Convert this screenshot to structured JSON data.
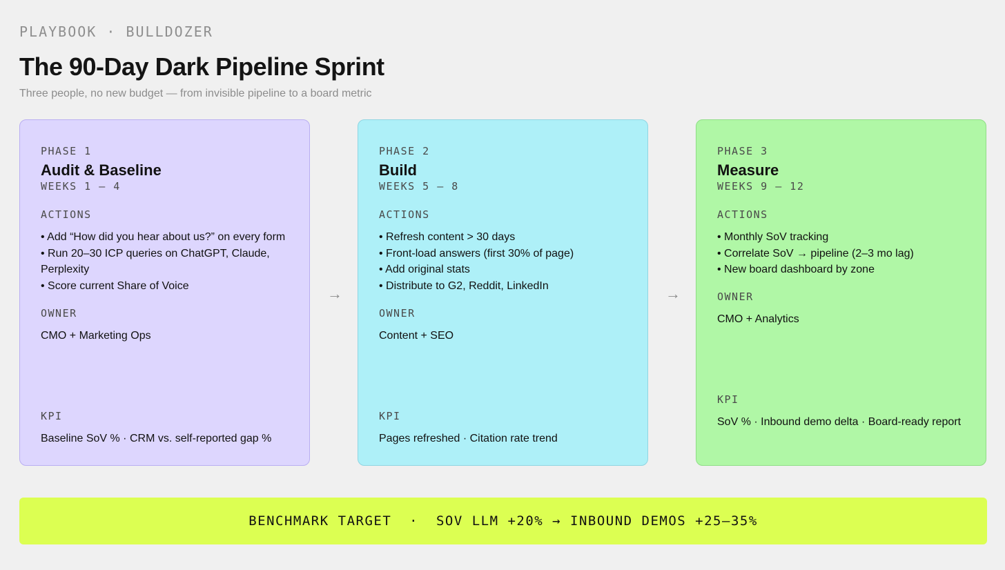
{
  "header": {
    "eyebrow": "PLAYBOOK · BULLDOZER",
    "title": "The 90-Day Dark Pipeline Sprint",
    "subtitle": "Three people, no new budget — from invisible pipeline to a board metric"
  },
  "phases": [
    {
      "label": "PHASE 1",
      "title": "Audit & Baseline",
      "weeks": "WEEKS 1 – 4",
      "actions_label": "ACTIONS",
      "actions": [
        "• Add “How did you hear about us?” on every form",
        "• Run 20–30 ICP queries on ChatGPT, Claude, Perplexity",
        "• Score current Share of Voice"
      ],
      "owner_label": "OWNER",
      "owner": "CMO + Marketing Ops",
      "kpi_label": "KPI",
      "kpi": "Baseline SoV % · CRM vs. self-reported gap %",
      "color": "#ddd6fe"
    },
    {
      "label": "PHASE 2",
      "title": "Build",
      "weeks": "WEEKS 5 – 8",
      "actions_label": "ACTIONS",
      "actions": [
        "• Refresh content > 30 days",
        "• Front-load answers (first 30% of page)",
        "• Add original stats",
        "• Distribute to G2, Reddit, LinkedIn"
      ],
      "owner_label": "OWNER",
      "owner": "Content + SEO",
      "kpi_label": "KPI",
      "kpi": "Pages refreshed · Citation rate trend",
      "color": "#aef0f8"
    },
    {
      "label": "PHASE 3",
      "title": "Measure",
      "weeks": "WEEKS 9 – 12",
      "actions_label": "ACTIONS",
      "actions": [
        "• Monthly SoV tracking",
        "• Correlate SoV → pipeline (2–3 mo lag)",
        "• New board dashboard by zone"
      ],
      "owner_label": "OWNER",
      "owner": "CMO + Analytics",
      "kpi_label": "KPI",
      "kpi": "SoV % · Inbound demo delta · Board-ready report",
      "color": "#b0f7a6"
    }
  ],
  "arrows": [
    "→",
    "→"
  ],
  "banner": {
    "text": "BENCHMARK TARGET  ·  SOV LLM +20% → INBOUND DEMOS +25–35%",
    "color": "#dcff52"
  }
}
